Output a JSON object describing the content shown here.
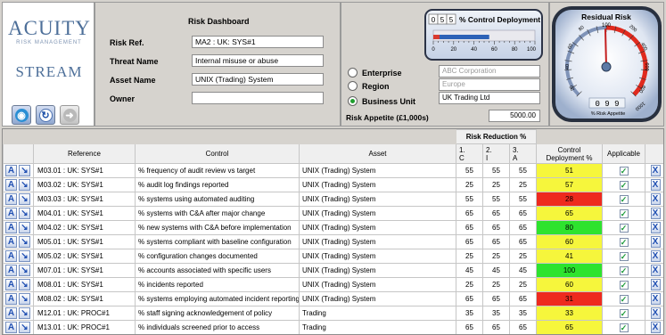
{
  "logo": {
    "acuity": "ACUITY",
    "tagline": "RISK MANAGEMENT",
    "stream": "STREAM"
  },
  "header": {
    "title": "Risk Dashboard",
    "risk_ref_label": "Risk Ref.",
    "risk_ref_value": "MA2 : UK: SYS#1",
    "threat_label": "Threat Name",
    "threat_value": "Internal misuse or abuse",
    "asset_label": "Asset Name",
    "asset_value": "UNIX (Trading) System",
    "owner_label": "Owner",
    "owner_value": ""
  },
  "scope": {
    "enterprise_label": "Enterprise",
    "enterprise_value": "ABC Corporation",
    "region_label": "Region",
    "region_value": "Europe",
    "business_unit_label": "Business Unit",
    "business_unit_value": "UK Trading Ltd",
    "selected": "Business Unit",
    "appetite_label": "Risk Appetite (£1,000s)",
    "appetite_value": "5000.00"
  },
  "control_gauge": {
    "digits": [
      "0",
      "5",
      "5"
    ],
    "title": "% Control Deployment",
    "ticks": [
      "0",
      "20",
      "40",
      "60",
      "80",
      "100"
    ],
    "value_percent": 55
  },
  "residual_gauge": {
    "title": "Residual Risk",
    "top_tick": "100",
    "ticks": [
      "20",
      "40",
      "60",
      "80",
      "200",
      "400",
      "600",
      "800",
      "1000"
    ],
    "readout": "0 9 9",
    "caption": "% Risk Appetite",
    "value": 99
  },
  "table": {
    "group_header": "Risk Reduction %",
    "headers": {
      "reference": "Reference",
      "control": "Control",
      "asset": "Asset",
      "c1": "1.",
      "c1_sub": "C",
      "c2": "2.",
      "c2_sub": "I",
      "c3": "3.",
      "c3_sub": "A",
      "deployment": "Control\nDeployment %",
      "applicable": "Applicable"
    },
    "action_a": "A",
    "action_arrow": "↘",
    "action_x": "X",
    "rows": [
      {
        "ref": "M03.01 : UK: SYS#1",
        "control": "% frequency of audit review vs target",
        "asset": "UNIX (Trading) System",
        "c": "55",
        "i": "55",
        "a": "55",
        "dep": "51",
        "color": "#f6f63c"
      },
      {
        "ref": "M03.02 : UK: SYS#1",
        "control": "% audit log findings reported",
        "asset": "UNIX (Trading) System",
        "c": "25",
        "i": "25",
        "a": "25",
        "dep": "57",
        "color": "#f6f63c"
      },
      {
        "ref": "M03.03 : UK: SYS#1",
        "control": "% systems using automated auditing",
        "asset": "UNIX (Trading) System",
        "c": "55",
        "i": "55",
        "a": "55",
        "dep": "28",
        "color": "#ee2a1e"
      },
      {
        "ref": "M04.01 : UK: SYS#1",
        "control": "% systems with C&A after major change",
        "asset": "UNIX (Trading) System",
        "c": "65",
        "i": "65",
        "a": "65",
        "dep": "65",
        "color": "#f6f63c"
      },
      {
        "ref": "M04.02 : UK: SYS#1",
        "control": "% new systems with C&A before implementation",
        "asset": "UNIX (Trading) System",
        "c": "65",
        "i": "65",
        "a": "65",
        "dep": "80",
        "color": "#2ee32e"
      },
      {
        "ref": "M05.01 : UK: SYS#1",
        "control": "% systems compliant with baseline configuration",
        "asset": "UNIX (Trading) System",
        "c": "65",
        "i": "65",
        "a": "65",
        "dep": "60",
        "color": "#f6f63c"
      },
      {
        "ref": "M05.02 : UK: SYS#1",
        "control": "% configuration changes documented",
        "asset": "UNIX (Trading) System",
        "c": "25",
        "i": "25",
        "a": "25",
        "dep": "41",
        "color": "#f6f63c"
      },
      {
        "ref": "M07.01 : UK: SYS#1",
        "control": "% accounts associated with specific users",
        "asset": "UNIX (Trading) System",
        "c": "45",
        "i": "45",
        "a": "45",
        "dep": "100",
        "color": "#2ee32e"
      },
      {
        "ref": "M08.01 : UK: SYS#1",
        "control": "% incidents reported",
        "asset": "UNIX (Trading) System",
        "c": "25",
        "i": "25",
        "a": "25",
        "dep": "60",
        "color": "#f6f63c"
      },
      {
        "ref": "M08.02 : UK: SYS#1",
        "control": "% systems employing automated incident reporting",
        "asset": "UNIX (Trading) System",
        "c": "65",
        "i": "65",
        "a": "65",
        "dep": "31",
        "color": "#ee2a1e"
      },
      {
        "ref": "M12.01 : UK: PROC#1",
        "control": "% staff signing acknowledgement of policy",
        "asset": "Trading",
        "c": "35",
        "i": "35",
        "a": "35",
        "dep": "33",
        "color": "#f6f63c"
      },
      {
        "ref": "M13.01 : UK: PROC#1",
        "control": "% individuals screened prior to access",
        "asset": "Trading",
        "c": "65",
        "i": "65",
        "a": "65",
        "dep": "65",
        "color": "#f6f63c"
      }
    ]
  }
}
